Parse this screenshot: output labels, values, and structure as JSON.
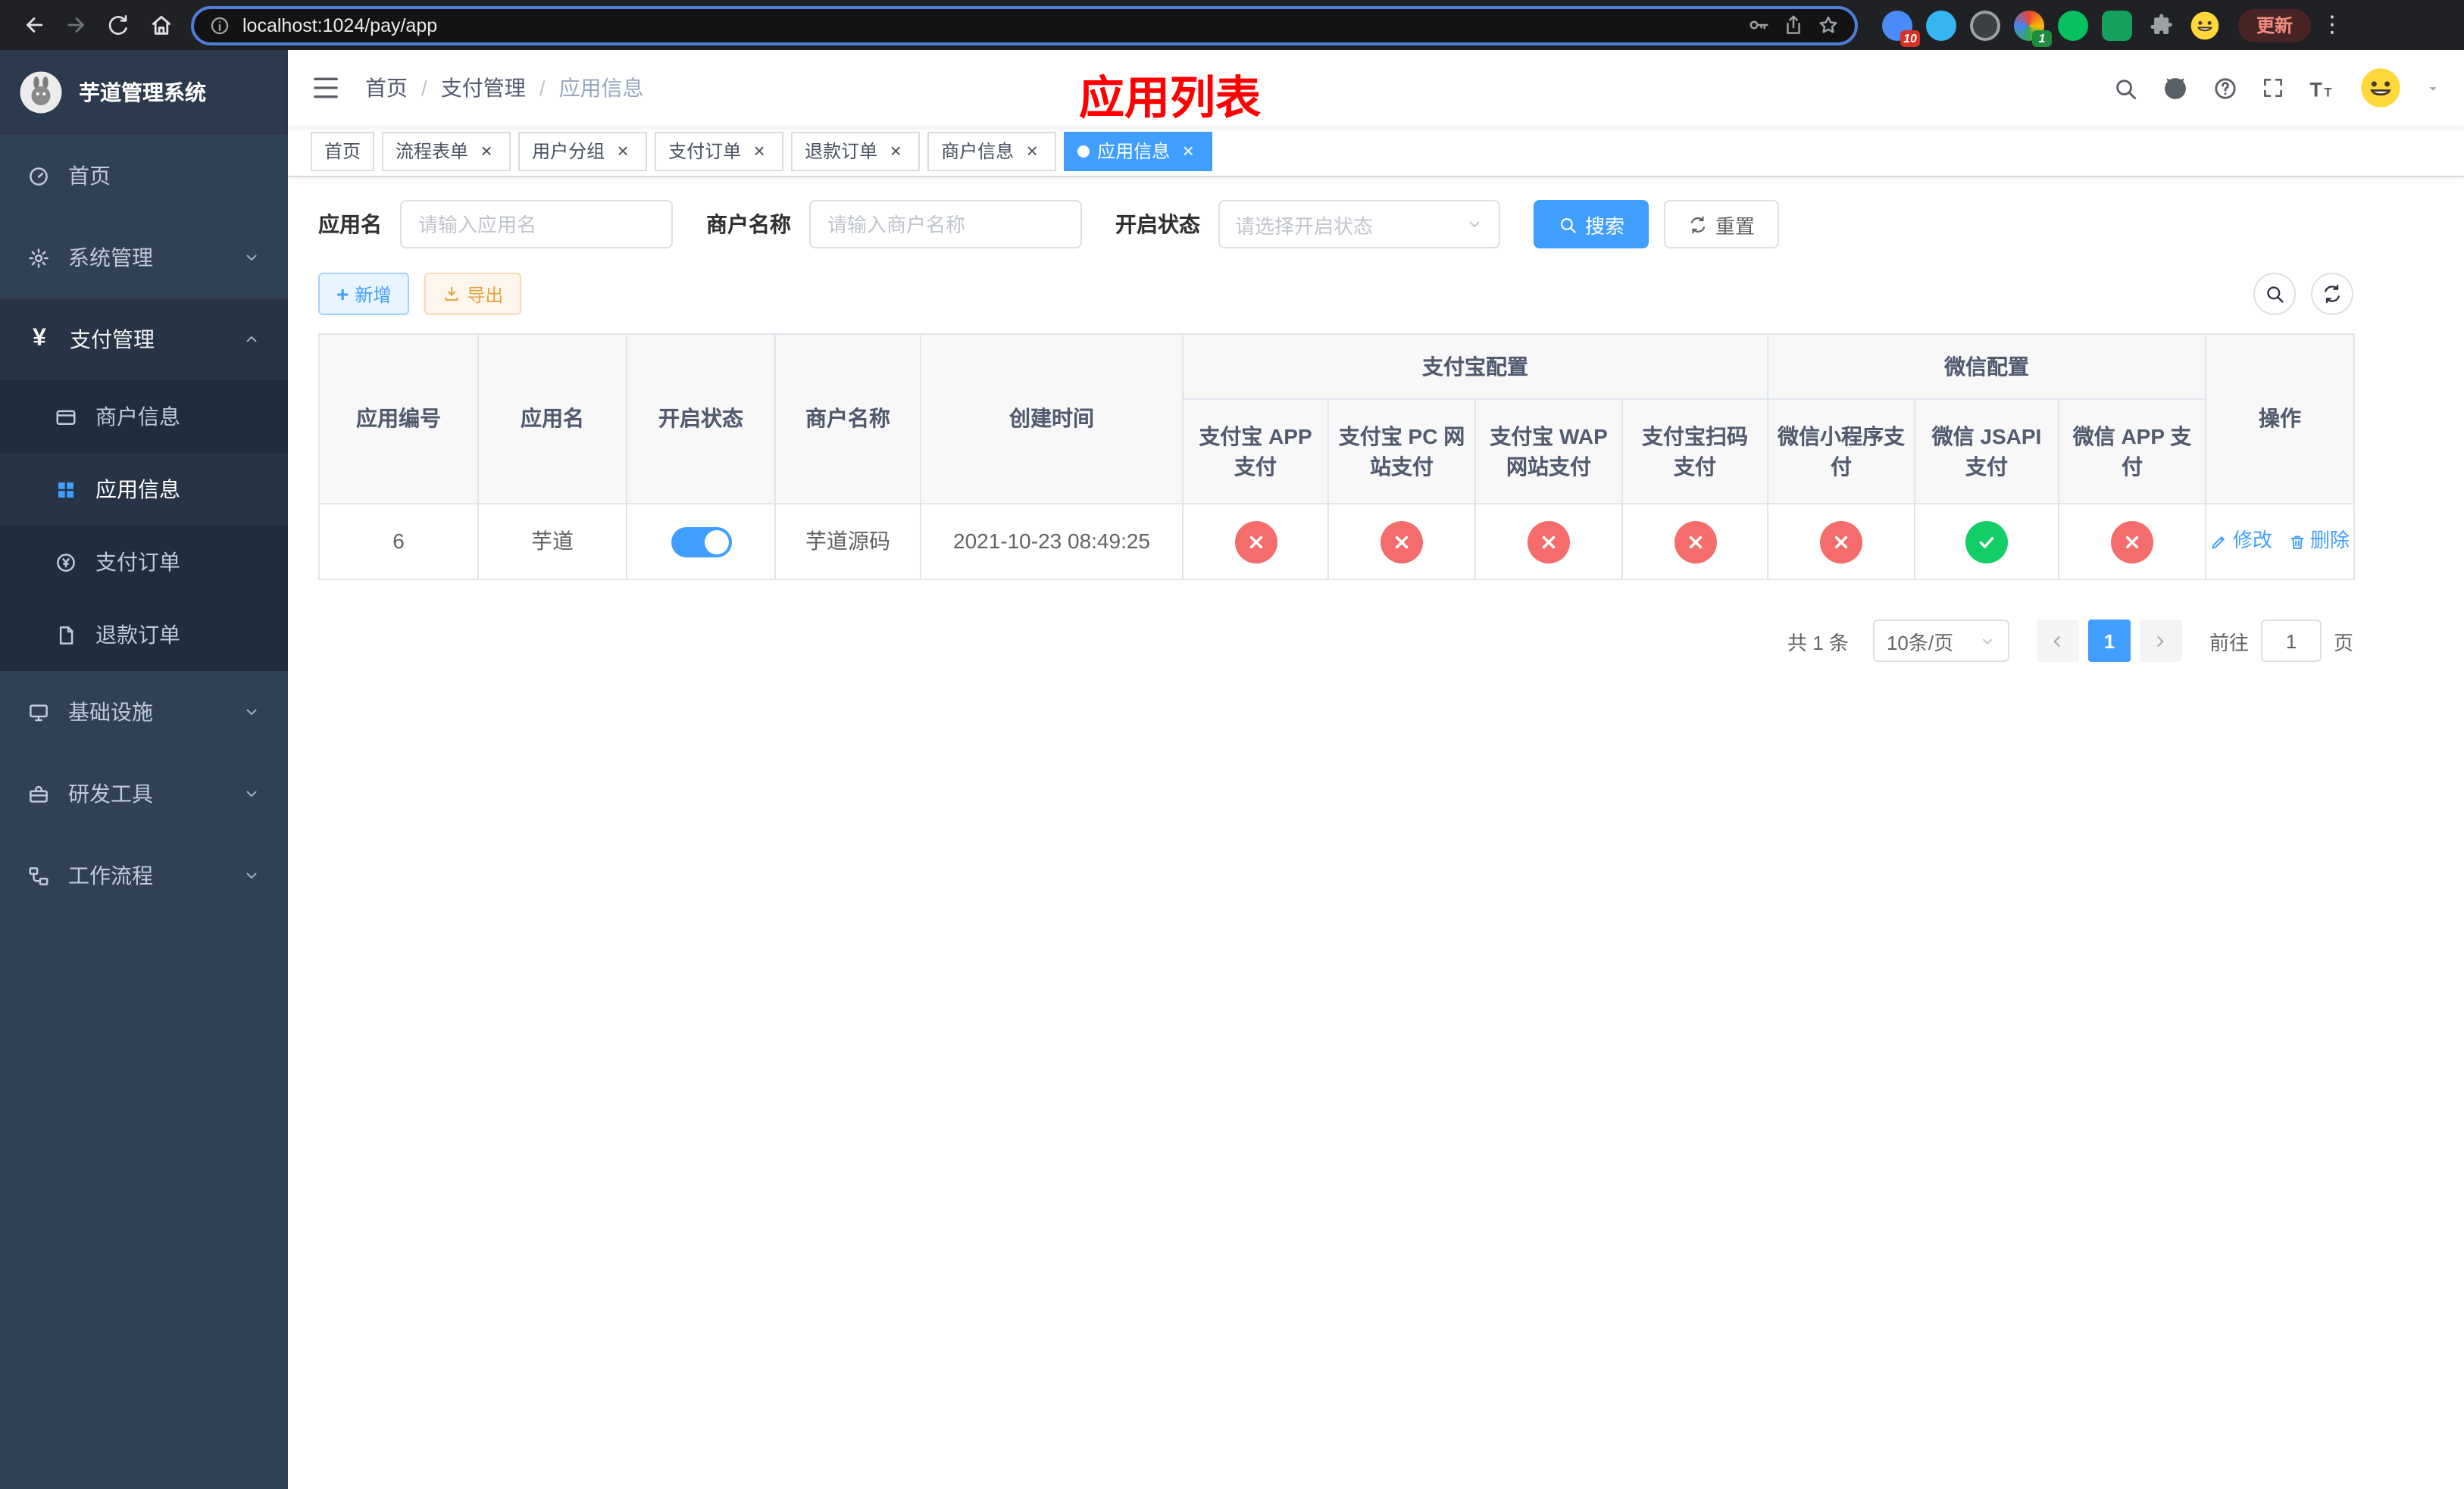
{
  "browser": {
    "url": "localhost:1024/pay/app",
    "update_button": "更新",
    "extension_badge_1": "10",
    "extension_badge_2": "1"
  },
  "icons": {
    "dots": "⋮",
    "close": "×",
    "yen": "¥",
    "plus": "+"
  },
  "sidebar": {
    "logo_title": "芋道管理系统",
    "home": "首页",
    "system": "系统管理",
    "payment": "支付管理",
    "merchant_info": "商户信息",
    "app_info": "应用信息",
    "pay_order": "支付订单",
    "refund_order": "退款订单",
    "infrastructure": "基础设施",
    "dev_tools": "研发工具",
    "workflow": "工作流程"
  },
  "header": {
    "breadcrumb_home": "首页",
    "breadcrumb_payment": "支付管理",
    "breadcrumb_current": "应用信息",
    "separator": "/",
    "page_title": "应用列表"
  },
  "tabs": [
    {
      "label": "首页",
      "active": false,
      "closable": false
    },
    {
      "label": "流程表单",
      "active": false,
      "closable": true
    },
    {
      "label": "用户分组",
      "active": false,
      "closable": true
    },
    {
      "label": "支付订单",
      "active": false,
      "closable": true
    },
    {
      "label": "退款订单",
      "active": false,
      "closable": true
    },
    {
      "label": "商户信息",
      "active": false,
      "closable": true
    },
    {
      "label": "应用信息",
      "active": true,
      "closable": true
    }
  ],
  "filters": {
    "app_name_label": "应用名",
    "app_name_placeholder": "请输入应用名",
    "merchant_label": "商户名称",
    "merchant_placeholder": "请输入商户名称",
    "status_label": "开启状态",
    "status_placeholder": "请选择开启状态",
    "search_button": "搜索",
    "reset_button": "重置"
  },
  "toolbar": {
    "add_button": "新增",
    "export_button": "导出"
  },
  "table": {
    "col_app_id": "应用编号",
    "col_app_name": "应用名",
    "col_status": "开启状态",
    "col_merchant": "商户名称",
    "col_created": "创建时间",
    "group_alipay": "支付宝配置",
    "group_wechat": "微信配置",
    "col_alipay_app": "支付宝 APP 支付",
    "col_alipay_pc": "支付宝 PC 网站支付",
    "col_alipay_wap": "支付宝 WAP 网站支付",
    "col_alipay_qr": "支付宝扫码支付",
    "col_wechat_mini": "微信小程序支付",
    "col_wechat_jsapi": "微信 JSAPI 支付",
    "col_wechat_app": "微信 APP 支付",
    "col_actions": "操作",
    "row": {
      "app_id": "6",
      "app_name": "芋道",
      "switch": "on",
      "merchant": "芋道源码",
      "created": "2021-10-23 08:49:25",
      "alipay_app": "fail",
      "alipay_pc": "fail",
      "alipay_wap": "fail",
      "alipay_qr": "fail",
      "wechat_mini": "fail",
      "wechat_jsapi": "pass",
      "wechat_app": "fail",
      "edit_link": "修改",
      "delete_link": "删除"
    }
  },
  "pagination": {
    "total": "共 1 条",
    "page_size": "10条/页",
    "current_page": "1",
    "goto_label": "前往",
    "goto_value": "1",
    "goto_unit": "页"
  },
  "colors": {
    "primary": "#409eff",
    "danger": "#f56c6c",
    "success": "#13ce66",
    "warning": "#e6a23c",
    "title_red": "#ff0000",
    "sidebar_bg": "#304156",
    "submenu_bg": "#1f2d3e"
  }
}
